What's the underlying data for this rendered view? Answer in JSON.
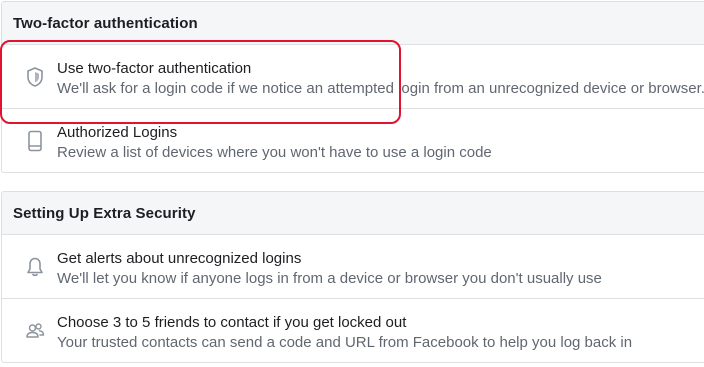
{
  "two_factor": {
    "header": "Two-factor authentication",
    "items": [
      {
        "icon": "shield-icon",
        "title": "Use two-factor authentication",
        "description": "We'll ask for a login code if we notice an attempted login from an unrecognized device or browser."
      },
      {
        "icon": "phone-icon",
        "title": "Authorized Logins",
        "description": "Review a list of devices where you won't have to use a login code"
      }
    ]
  },
  "extra_security": {
    "header": "Setting Up Extra Security",
    "items": [
      {
        "icon": "bell-icon",
        "title": "Get alerts about unrecognized logins",
        "description": "We'll let you know if anyone logs in from a device or browser you don't usually use"
      },
      {
        "icon": "friends-icon",
        "title": "Choose 3 to 5 friends to contact if you get locked out",
        "description": "Your trusted contacts can send a code and URL from Facebook to help you log back in"
      }
    ]
  },
  "colors": {
    "highlight": "#e0142e",
    "header_bg": "#f5f6f7",
    "border": "#dddfe2",
    "title_text": "#1c1e21",
    "desc_text": "#606770",
    "icon": "#8d949e"
  }
}
